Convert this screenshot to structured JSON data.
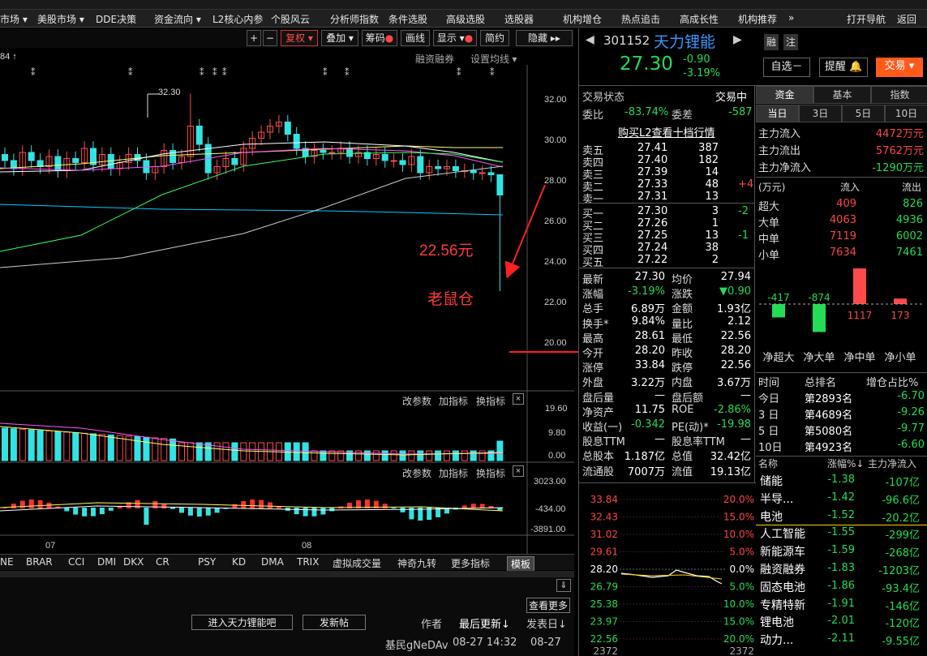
{
  "menu": [
    "市场",
    "美股市场",
    "DDE决策",
    "资金流向",
    "L2核心内参",
    "个股风云",
    "分析师指数",
    "条件选股",
    "高级选股",
    "选股器",
    "机构增仓",
    "热点追击",
    "高成长性",
    "机构推荐",
    "»",
    "打开导航",
    "返回"
  ],
  "toolbar": {
    "plus": "+",
    "minus": "−",
    "fuquan": "复权",
    "diejia": "叠加",
    "chouma": "筹码",
    "huaxian": "画线",
    "xianshi": "显示",
    "jianyue": "简约",
    "yincang": "隐藏"
  },
  "chart": {
    "top_left": "84",
    "rzrq": "融资融券",
    "sz_jx": "设置均线",
    "y_ticks": [
      "32.00",
      "30.00",
      "28.00",
      "26.00",
      "24.00",
      "22.00",
      "20.00"
    ],
    "high_label": "32.30",
    "anno_price": "22.56元",
    "anno_text": "老鼠仓",
    "vol_params": "改参数",
    "vol_add": "加指标",
    "vol_change": "换指标",
    "vol_ticks": [
      "19.60",
      "9.80",
      "0.00"
    ],
    "macd_ticks": [
      "3023.00",
      "-434.00",
      "-3891.00"
    ],
    "months": [
      "07",
      "08"
    ],
    "indicators": [
      "NE",
      "BRAR",
      "CCI",
      "DMI",
      "DKX",
      "CR",
      "PSY",
      "KD",
      "DMA",
      "TRIX",
      "虚拟成交量",
      "神奇九转",
      "更多指标",
      "模板"
    ]
  },
  "bottom": {
    "goto_bar": "进入天力锂能吧",
    "post": "发新帖",
    "author": "作者",
    "last_update": "最后更新↓",
    "post_date": "发表日↓",
    "more": "查看更多",
    "reply_user": "基民gNeDAv",
    "reply_time": "08-27 14:32",
    "reply_date": "08-27"
  },
  "stock": {
    "code": "301152",
    "name": "天力锂能",
    "price": "27.30",
    "change": "-0.90",
    "pct": "-3.19%",
    "rong": "融",
    "zhu": "注",
    "zixuan": "自选－",
    "tixing": "提醒",
    "jiaoyi": "交易"
  },
  "trade_status": {
    "label": "交易状态",
    "value": "交易中",
    "weibi_label": "委比",
    "weibi": "-83.74%",
    "weicha_label": "委差",
    "weicha": "-587",
    "l2": "购买L2查看十档行情"
  },
  "asks": [
    [
      "卖五",
      "27.41",
      "387",
      ""
    ],
    [
      "卖四",
      "27.40",
      "182",
      ""
    ],
    [
      "卖三",
      "27.39",
      "14",
      ""
    ],
    [
      "卖二",
      "27.33",
      "48",
      "+4"
    ],
    [
      "卖一",
      "27.31",
      "13",
      ""
    ]
  ],
  "bids": [
    [
      "买一",
      "27.30",
      "3",
      "-2"
    ],
    [
      "买二",
      "27.26",
      "1",
      ""
    ],
    [
      "买三",
      "27.25",
      "13",
      "-1"
    ],
    [
      "买四",
      "27.24",
      "38",
      ""
    ],
    [
      "买五",
      "27.22",
      "2",
      ""
    ]
  ],
  "quote": [
    [
      "最新",
      "27.30",
      "均价",
      "27.94"
    ],
    [
      "涨幅",
      "-3.19%",
      "涨跌",
      "▼0.90"
    ],
    [
      "总手",
      "6.89万",
      "金额",
      "1.93亿"
    ],
    [
      "换手*",
      "9.84%",
      "量比",
      "2.12"
    ],
    [
      "最高",
      "28.61",
      "最低",
      "22.56"
    ],
    [
      "今开",
      "28.20",
      "昨收",
      "28.20"
    ],
    [
      "涨停",
      "33.84",
      "跌停",
      "22.56"
    ],
    [
      "外盘",
      "3.22万",
      "内盘",
      "3.67万"
    ],
    [
      "盘后量",
      "—",
      "盘后额",
      "—"
    ],
    [
      "净资产",
      "11.75",
      "ROE",
      "-2.86%"
    ],
    [
      "收益(一)",
      "-0.342",
      "PE(动)*",
      "-19.98"
    ],
    [
      "股息TTM",
      "—",
      "股息率TTM",
      "—"
    ],
    [
      "总股本",
      "1.187亿",
      "总值",
      "32.42亿"
    ],
    [
      "流通股",
      "7007万",
      "流值",
      "19.13亿"
    ]
  ],
  "fund_tabs": [
    "资金",
    "基本",
    "指数"
  ],
  "day_tabs": [
    "当日",
    "3日",
    "5日",
    "10日"
  ],
  "fund_flow": [
    [
      "主力流入",
      "4472万元"
    ],
    [
      "主力流出",
      "5762万元"
    ],
    [
      "主力净流入",
      "-1290万元"
    ]
  ],
  "flow_head": [
    "(万元)",
    "流入",
    "流出"
  ],
  "flow_table": [
    [
      "超大",
      "409",
      "826"
    ],
    [
      "大单",
      "4063",
      "4936"
    ],
    [
      "中单",
      "7119",
      "6002"
    ],
    [
      "小单",
      "7634",
      "7461"
    ]
  ],
  "net_bars": {
    "values": [
      -417,
      -874,
      1117,
      173
    ],
    "labels": [
      "净超大",
      "净大单",
      "净中单",
      "净小单"
    ]
  },
  "rank_head": [
    "时间",
    "总排名",
    "增仓占比%"
  ],
  "rank": [
    [
      "今日",
      "第2893名",
      "-6.70"
    ],
    [
      "3 日",
      "第4689名",
      "-9.26"
    ],
    [
      "5 日",
      "第5080名",
      "-9.77"
    ],
    [
      "10日",
      "第4923名",
      "-6.60"
    ]
  ],
  "sector_head": [
    "名称",
    "涨幅%↓",
    "主力净流入"
  ],
  "sectors": [
    [
      "储能",
      "-1.38",
      "-107亿"
    ],
    [
      "半导...",
      "-1.42",
      "-96.6亿"
    ],
    [
      "电池",
      "-1.52",
      "-20.2亿"
    ],
    [
      "人工智能",
      "-1.55",
      "-299亿"
    ],
    [
      "新能源车",
      "-1.59",
      "-268亿"
    ],
    [
      "融资融券",
      "-1.83",
      "-1203亿"
    ],
    [
      "固态电池",
      "-1.86",
      "-93.4亿"
    ],
    [
      "专精特新",
      "-1.91",
      "-146亿"
    ],
    [
      "锂电池",
      "-2.01",
      "-120亿"
    ],
    [
      "动力...",
      "-2.11",
      "-9.55亿"
    ]
  ],
  "intraday": {
    "left": [
      "33.84",
      "32.43",
      "31.02",
      "29.61",
      "28.20",
      "26.79",
      "25.38",
      "23.97",
      "22.56",
      "2372"
    ],
    "right": [
      "20.0%",
      "15.0%",
      "10.0%",
      "5.0%",
      "0.0%",
      "5.0%",
      "10.0%",
      "15.0%",
      "20.0%",
      "2372"
    ]
  }
}
